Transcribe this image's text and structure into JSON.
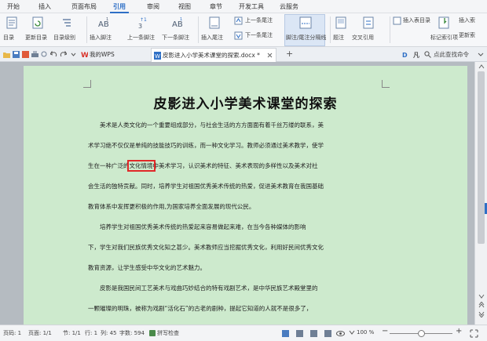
{
  "menu": {
    "tabs": [
      "开始",
      "插入",
      "页面布局",
      "引用",
      "审阅",
      "视图",
      "章节",
      "开发工具",
      "云服务"
    ],
    "active": "引用"
  },
  "ribbon": {
    "toc": "目录",
    "update_toc": "更新目录",
    "toc_level": "目录级别",
    "insert_footnote": "插入脚注",
    "prev_footnote": "上一条脚注",
    "next_footnote": "下一条脚注",
    "insert_endnote": "插入尾注",
    "prev_endnote": "上一条尾注",
    "next_endnote": "下一条尾注",
    "footnote_separator": "脚注/尾注分隔线",
    "caption": "题注",
    "cross_reference": "交叉引用",
    "insert_table_of_figures": "插入表目录",
    "mark_index_entry": "标记索引项",
    "insert_index": "插入索",
    "update_index": "更新索"
  },
  "tabs": {
    "my_wps": "我的WPS",
    "document": "皮影进入小学美术课堂的探索.docx *",
    "new_tab": "+"
  },
  "search": {
    "placeholder": "点此查找命令"
  },
  "document": {
    "title": "皮影进入小学美术课堂的探索",
    "paragraphs": [
      {
        "lines": [
          "　　美术是人类文化的一个重要组成部分，与社会生活的方方面面有着千丝万缕的联系，美",
          "术学习绝不仅仅是单纯的技能技巧的训练，而一种文化学习。教师必须通过美术教学，使学"
        ],
        "highlight_line": "生在一种广泛的",
        "highlight": "文化情境",
        "highlight_rest": "中美术学习，认识美术的特征、美术表现的多样性以及美术对社",
        "more": [
          "会生活的独特贡献。同时，培养学生对祖国优秀美术传统的热爱，促进美术教育在我国基础",
          "教育体系中发挥更积极的作用,为国家培养全面发展的现代公民。"
        ]
      },
      {
        "lines": [
          "　　培养学生对祖国优秀美术传统的热爱起来容易做起来难，在当今各种媒体的影响",
          "下，学生对我们民族优秀文化知之甚少。美术教师应当挖掘优秀文化，利用好民间优秀文化",
          "教育资源，让学生感受中华文化的艺术魅力。"
        ]
      },
      {
        "lines": [
          "　　皮影是我国民间工艺美术与戏曲巧妙结合的特有戏剧艺术，是中华民族艺术殿堂里的",
          "一颗璀璨的明珠，被称为戏剧“活化石”的古老的剧种，提起它知道的人就不是很多了，"
        ]
      }
    ]
  },
  "status": {
    "page": "页码: 1",
    "pages": "页面: 1/1",
    "section": "节: 1/1",
    "row": "行: 1",
    "col": "列: 45",
    "words": "字数: 594",
    "spell": "拼写检查",
    "zoom": "100 %"
  },
  "colors": {
    "accent": "#2e6fc6",
    "page_bg": "#cdeacd",
    "highlight_box": "#e02828"
  }
}
